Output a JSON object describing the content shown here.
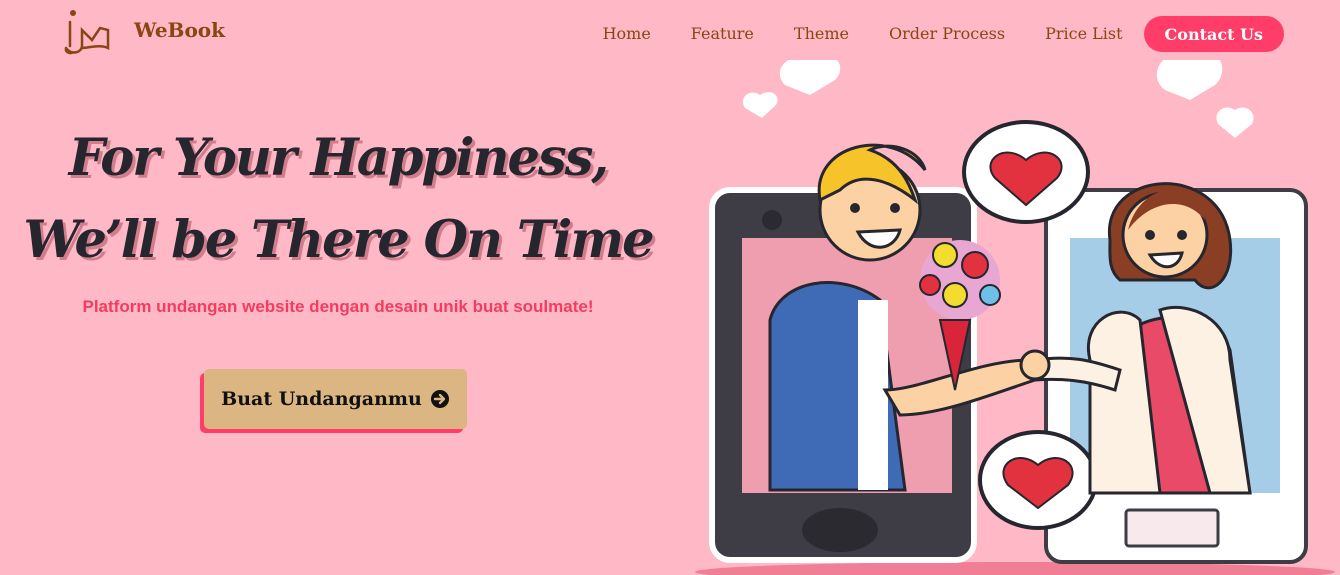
{
  "header": {
    "logo_text": "WeBook",
    "nav": [
      "Home",
      "Feature",
      "Theme",
      "Order Process",
      "Price List"
    ],
    "contact_label": "Contact Us"
  },
  "hero": {
    "title_line1": "For Your Happiness,",
    "title_line2": "We’ll be There On Time",
    "subtitle": "Platform undangan website dengan desain unik buat soulmate!",
    "cta_label": "Buat Undanganmu"
  },
  "icons": {
    "cta_icon": "arrow-circle-right-icon",
    "logo_icon": "logo-icon"
  },
  "colors": {
    "background": "#ffb8c5",
    "brand": "#8b4513",
    "accent": "#ff3d68",
    "cta": "#dbb582",
    "title": "#26262e"
  }
}
